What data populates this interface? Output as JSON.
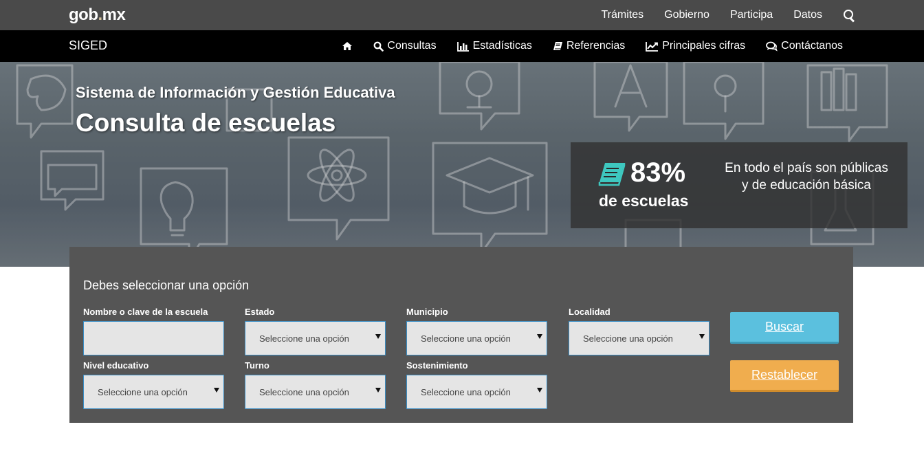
{
  "topbar": {
    "logo_left": "gob",
    "logo_dot": ".",
    "logo_right": "mx",
    "nav": [
      "Trámites",
      "Gobierno",
      "Participa",
      "Datos"
    ],
    "search_icon": "search-icon"
  },
  "subbar": {
    "brand": "SIGED",
    "nav": [
      {
        "icon": "home-icon",
        "label": ""
      },
      {
        "icon": "search-icon",
        "label": "Consultas"
      },
      {
        "icon": "bar-chart-icon",
        "label": "Estadísticas"
      },
      {
        "icon": "book-icon",
        "label": "Referencias"
      },
      {
        "icon": "line-chart-icon",
        "label": "Principales cifras"
      },
      {
        "icon": "comments-icon",
        "label": "Contáctanos"
      }
    ]
  },
  "hero": {
    "subtitle": "Sistema de Información y Gestión Educativa",
    "title": "Consulta de escuelas",
    "stat": {
      "value": "83%",
      "label": "de escuelas",
      "description": "En todo el país son públicas y de educación básica",
      "icon": "book-icon",
      "accent": "#3ec8c0"
    }
  },
  "form": {
    "title": "Debes seleccionar una opción",
    "fields": {
      "nombre": {
        "label": "Nombre o clave de la escuela",
        "value": "",
        "placeholder": ""
      },
      "estado": {
        "label": "Estado",
        "value": "Seleccione una opción"
      },
      "municipio": {
        "label": "Municipio",
        "value": "Seleccione una opción"
      },
      "localidad": {
        "label": "Localidad",
        "value": "Seleccione una opción"
      },
      "nivel": {
        "label": "Nivel educativo",
        "value": "Seleccione una opción"
      },
      "turno": {
        "label": "Turno",
        "value": "Seleccione una opción"
      },
      "sostenimiento": {
        "label": "Sostenimiento",
        "value": "Seleccione una opción"
      }
    },
    "buttons": {
      "search": "Buscar",
      "reset": "Restablecer"
    }
  },
  "colors": {
    "topbar": "#4a4a4a",
    "subbar": "#000000",
    "panel": "#555555",
    "search_button": "#5bc0de",
    "reset_button": "#f0ad4e"
  }
}
